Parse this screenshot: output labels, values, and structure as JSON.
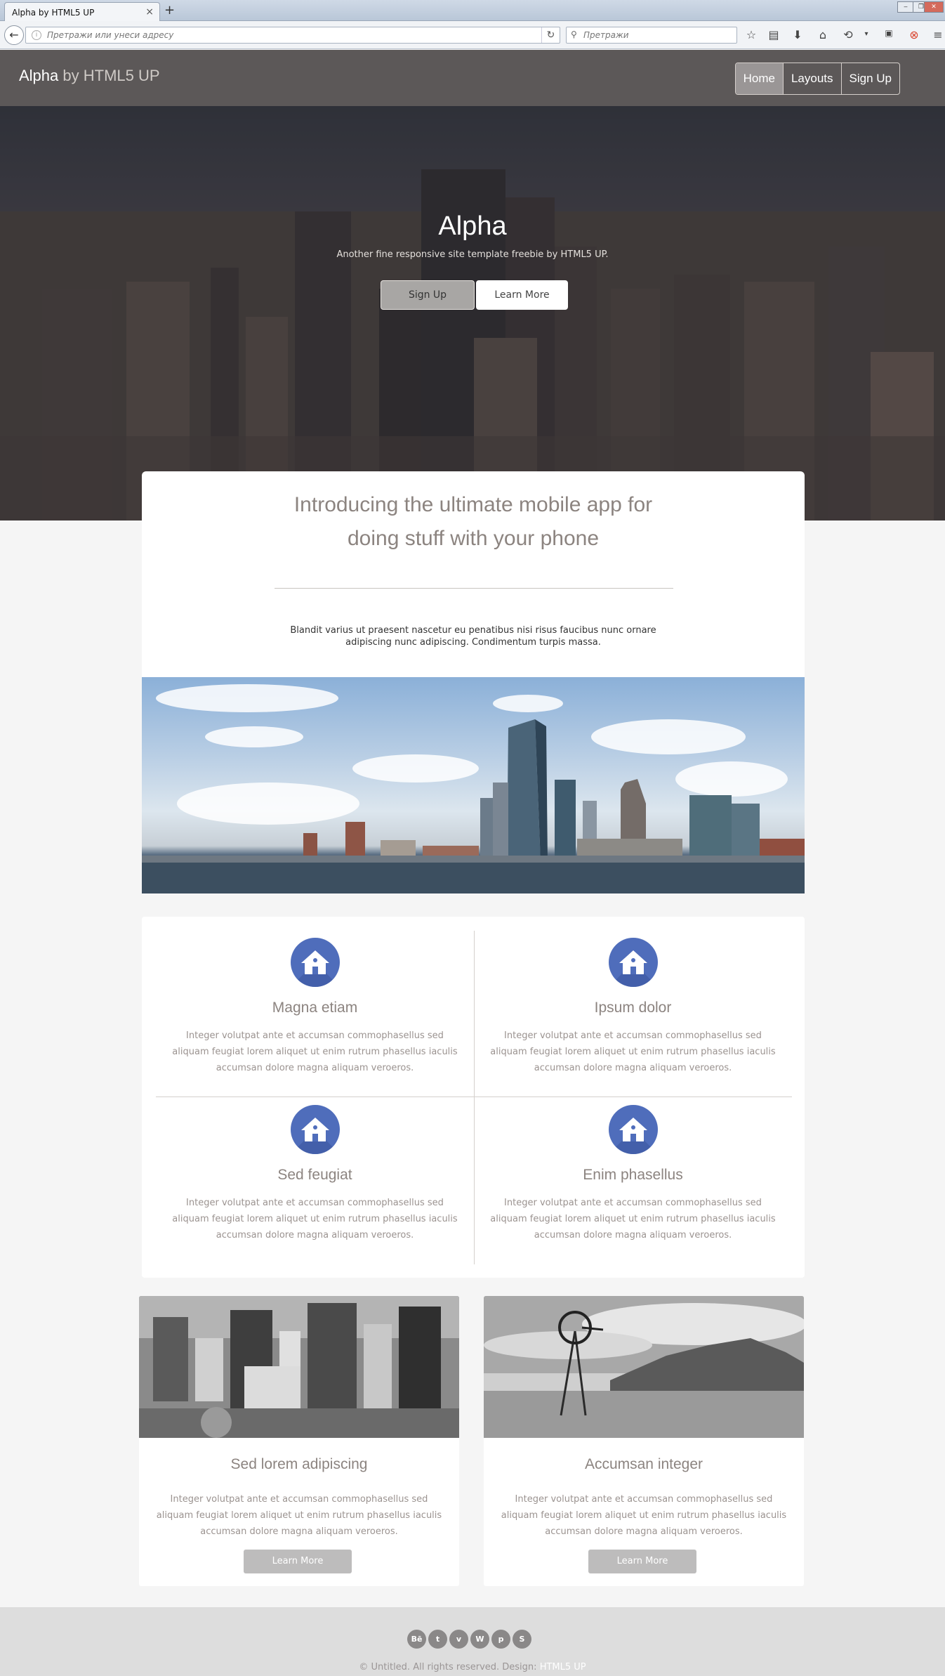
{
  "browser": {
    "tab_title": "Alpha by HTML5 UP",
    "tab_close": "×",
    "new_tab": "+",
    "url_placeholder": "Претражи или унеси адресу",
    "search_placeholder": "Претражи",
    "icons": [
      "back-arrow-icon",
      "info-icon",
      "reload-icon",
      "search-icon",
      "bookmark-star-icon",
      "reading-list-icon",
      "download-icon",
      "home-icon",
      "sync-icon",
      "dropdown-icon",
      "youtube-icon",
      "lifebuoy-icon",
      "menu-icon"
    ]
  },
  "header": {
    "logo_main": "Alpha",
    "logo_sub": "by HTML5 UP",
    "nav": [
      "Home",
      "Layouts",
      "Sign Up"
    ]
  },
  "hero": {
    "title": "Alpha",
    "subtitle": "Another fine responsive site template freebie by HTML5 UP.",
    "btn_signup": "Sign Up",
    "btn_learn": "Learn More"
  },
  "intro": {
    "title_line1": "Introducing the ultimate mobile app for",
    "title_line2": "doing stuff with your phone",
    "text_line1": "Blandit varius ut praesent nascetur eu penatibus nisi risus faucibus nunc ornare",
    "text_line2": "adipiscing nunc adipiscing. Condimentum turpis massa."
  },
  "features": [
    {
      "title": "Magna etiam",
      "text": "Integer volutpat ante et accumsan commophasellus sed aliquam feugiat lorem aliquet ut enim rutrum phasellus iaculis accumsan dolore magna aliquam veroeros."
    },
    {
      "title": "Ipsum dolor",
      "text": "Integer volutpat ante et accumsan commophasellus sed aliquam feugiat lorem aliquet ut enim rutrum phasellus iaculis accumsan dolore magna aliquam veroeros."
    },
    {
      "title": "Sed feugiat",
      "text": "Integer volutpat ante et accumsan commophasellus sed aliquam feugiat lorem aliquet ut enim rutrum phasellus iaculis accumsan dolore magna aliquam veroeros."
    },
    {
      "title": "Enim phasellus",
      "text": "Integer volutpat ante et accumsan commophasellus sed aliquam feugiat lorem aliquet ut enim rutrum phasellus iaculis accumsan dolore magna aliquam veroeros."
    }
  ],
  "boxes": [
    {
      "title": "Sed lorem adipiscing",
      "text": "Integer volutpat ante et accumsan commophasellus sed aliquam feugiat lorem aliquet ut enim rutrum phasellus iaculis accumsan dolore magna aliquam veroeros.",
      "button": "Learn More"
    },
    {
      "title": "Accumsan integer",
      "text": "Integer volutpat ante et accumsan commophasellus sed aliquam feugiat lorem aliquet ut enim rutrum phasellus iaculis accumsan dolore magna aliquam veroeros.",
      "button": "Learn More"
    }
  ],
  "footer": {
    "socials": [
      "Bē",
      "t",
      "v",
      "W",
      "p",
      "S"
    ],
    "copyright_text": "© Untitled. All rights reserved. Design:",
    "copyright_link": "HTML5 UP"
  },
  "colors": {
    "header_bg": "#5c5858",
    "icon_blue": "#4f6dbb",
    "footer_bg": "#dddddd"
  }
}
